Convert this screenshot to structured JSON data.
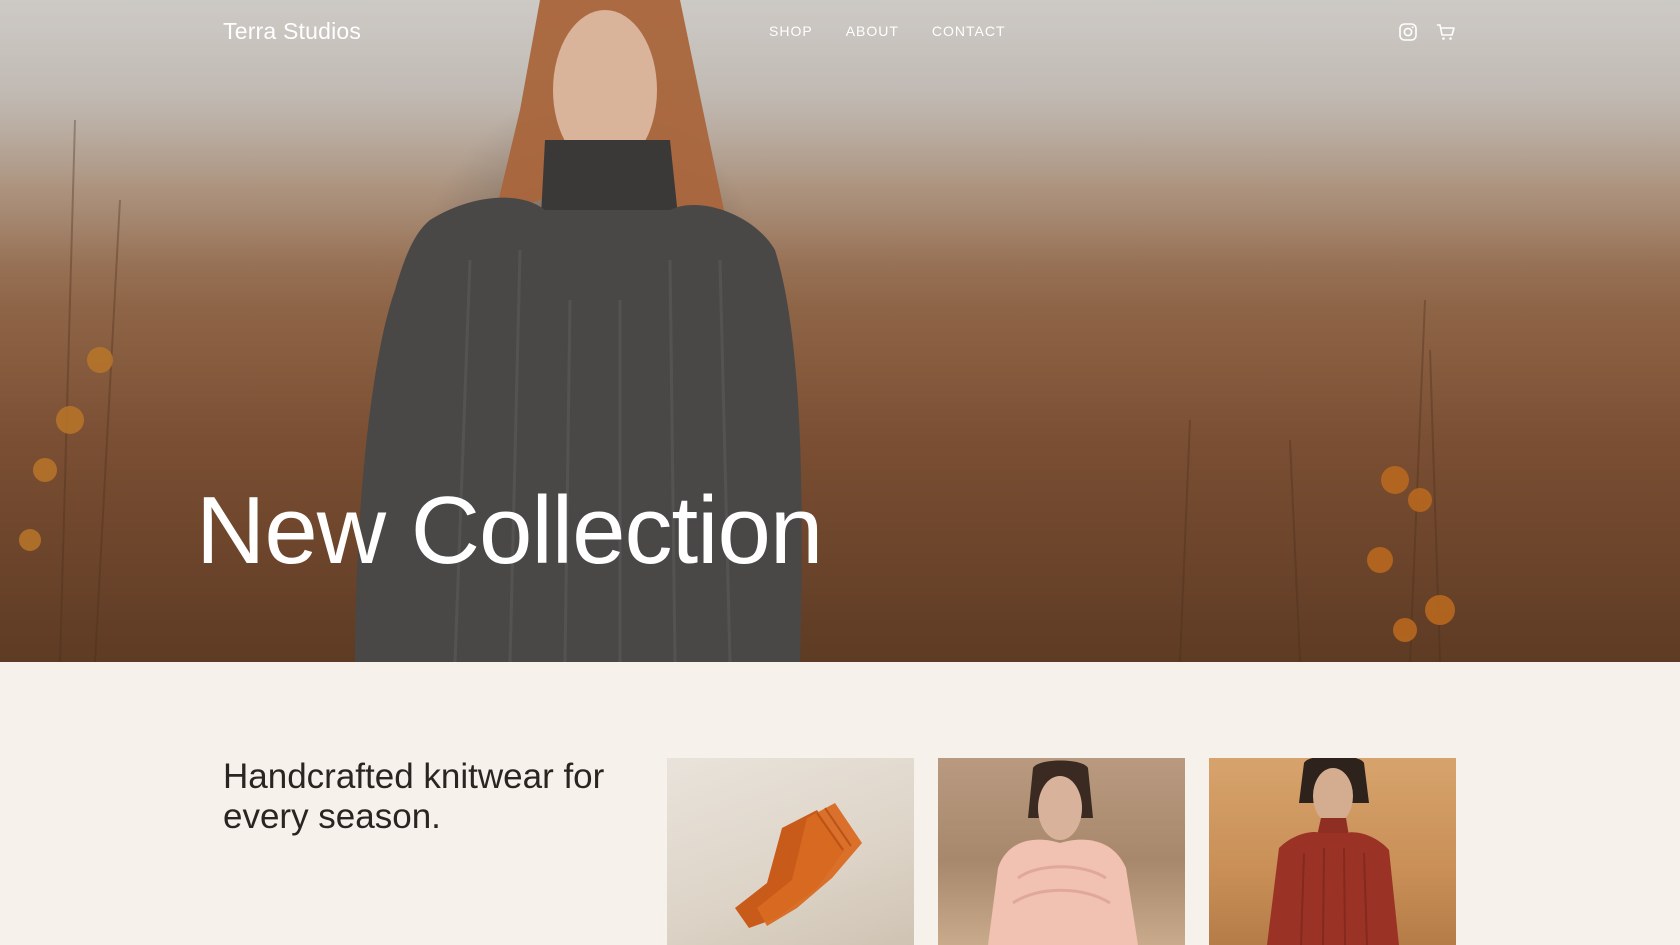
{
  "brand": {
    "name": "Terra Studios"
  },
  "nav": {
    "items": [
      {
        "label": "SHOP"
      },
      {
        "label": "ABOUT"
      },
      {
        "label": "CONTACT"
      }
    ]
  },
  "header_icons": {
    "social": "instagram-icon",
    "cart": "cart-icon"
  },
  "hero": {
    "title": "New Collection",
    "image": "woman-in-grey-turtleneck-sweater-in-misty-autumn-field"
  },
  "intro": {
    "text": "Handcrafted knitwear for every season."
  },
  "products": [
    {
      "image": "orange-knit-socks"
    },
    {
      "image": "pink-knit-scarf-wrap"
    },
    {
      "image": "red-knit-sweater"
    }
  ],
  "colors": {
    "page_background": "#f7f1ec",
    "text": "#2a2520",
    "hero_text": "#ffffff"
  }
}
